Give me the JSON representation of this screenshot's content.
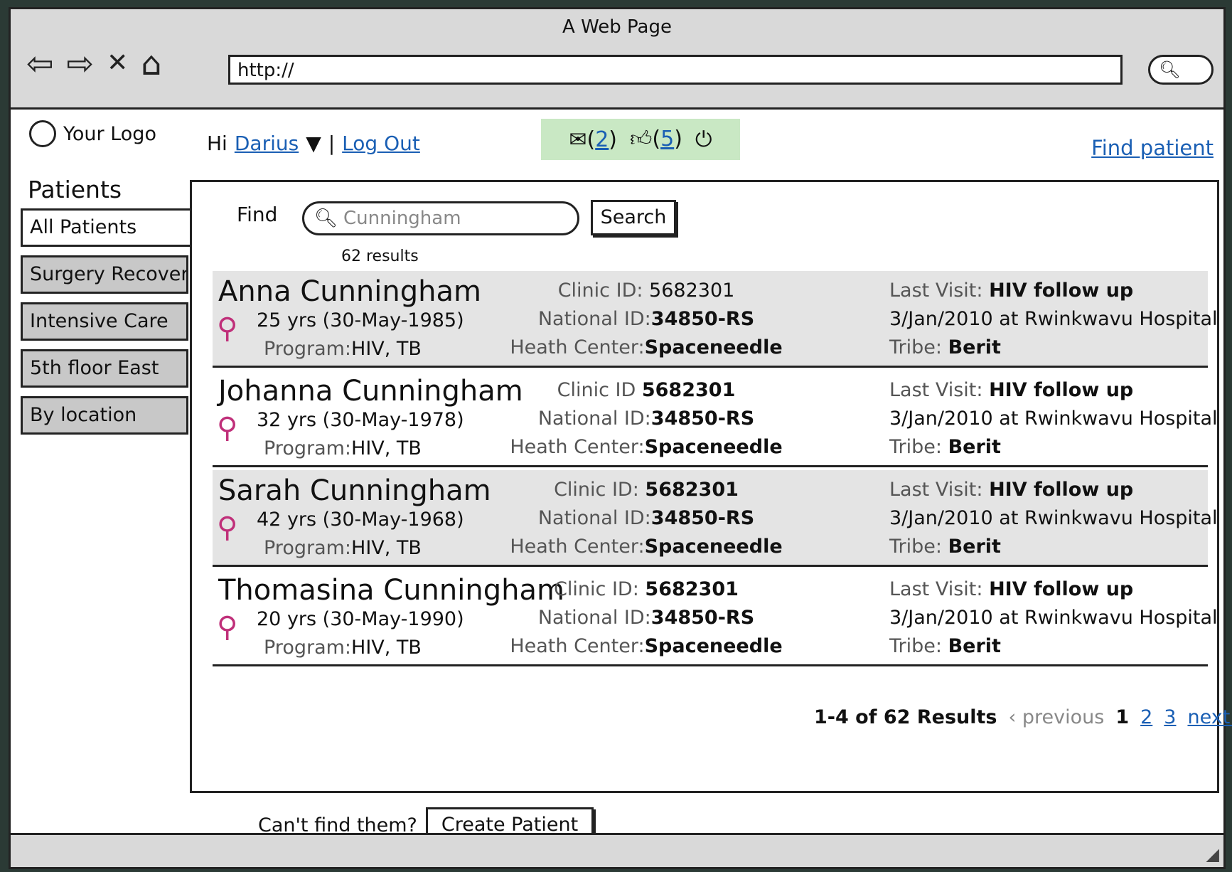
{
  "browser": {
    "title": "A Web Page",
    "url": "http://",
    "search_icon": "search-icon"
  },
  "header": {
    "logo_text": "Your Logo",
    "greeting": "Hi",
    "user_name": "Darius",
    "logout": "Log Out",
    "messages_count": "2",
    "likes_count": "5",
    "find_patient": "Find patient"
  },
  "sidebar": {
    "title": "Patients",
    "items": [
      {
        "label": "All Patients"
      },
      {
        "label": "Surgery Recovery"
      },
      {
        "label": "Intensive Care"
      },
      {
        "label": "5th floor East"
      },
      {
        "label": "By location"
      }
    ]
  },
  "search": {
    "label": "Find",
    "value": "Cunningham",
    "button": "Search",
    "result_count": "62 results"
  },
  "patients": [
    {
      "name": "Anna Cunningham",
      "age": "25 yrs (30-May-1985)",
      "program_label": "Program:",
      "program": "HIV, TB",
      "clinic_label": "Clinic ID:",
      "clinic_id": "5682301",
      "national_label": "National ID:",
      "national_id": "34850-RS",
      "health_label": "Heath Center:",
      "health_center": "Spaceneedle",
      "visit_label": "Last Visit:",
      "visit_type": "HIV follow up",
      "visit_detail": "3/Jan/2010 at Rwinkwavu Hospital",
      "tribe_label": "Tribe:",
      "tribe": "Berit"
    },
    {
      "name": "Johanna Cunningham",
      "age": "32 yrs (30-May-1978)",
      "program_label": "Program:",
      "program": "HIV, TB",
      "clinic_label": "Clinic ID",
      "clinic_id": "5682301",
      "national_label": "National ID:",
      "national_id": "34850-RS",
      "health_label": "Heath Center:",
      "health_center": "Spaceneedle",
      "visit_label": "Last Visit:",
      "visit_type": "HIV follow up",
      "visit_detail": "3/Jan/2010 at Rwinkwavu Hospital",
      "tribe_label": "Tribe:",
      "tribe": "Berit"
    },
    {
      "name": "Sarah Cunningham",
      "age": "42 yrs (30-May-1968)",
      "program_label": "Program:",
      "program": "HIV, TB",
      "clinic_label": "Clinic ID:",
      "clinic_id": "5682301",
      "national_label": "National ID:",
      "national_id": "34850-RS",
      "health_label": "Heath Center:",
      "health_center": "Spaceneedle",
      "visit_label": "Last Visit:",
      "visit_type": "HIV follow up",
      "visit_detail": "3/Jan/2010 at Rwinkwavu Hospital",
      "tribe_label": "Tribe:",
      "tribe": "Berit"
    },
    {
      "name": "Thomasina Cunningham",
      "age": "20 yrs (30-May-1990)",
      "program_label": "Program:",
      "program": "HIV, TB",
      "clinic_label": "Clinic ID:",
      "clinic_id": "5682301",
      "national_label": "National ID:",
      "national_id": "34850-RS",
      "health_label": "Heath Center:",
      "health_center": "Spaceneedle",
      "visit_label": "Last Visit:",
      "visit_type": "HIV follow up",
      "visit_detail": "3/Jan/2010 at Rwinkwavu Hospital",
      "tribe_label": "Tribe:",
      "tribe": "Berit"
    }
  ],
  "pagination": {
    "summary": "1-4 of 62 Results",
    "previous": "‹ previous",
    "current": "1",
    "pages": [
      "2",
      "3"
    ],
    "next": "next ›"
  },
  "footer": {
    "cant_find": "Can't find them?",
    "create_button": "Create Patient"
  },
  "colors": {
    "notification_bg": "#c9e8c4",
    "link": "#1a5fb4",
    "row_shade": "#e4e4e4",
    "patient_icon": "#c0307a"
  }
}
